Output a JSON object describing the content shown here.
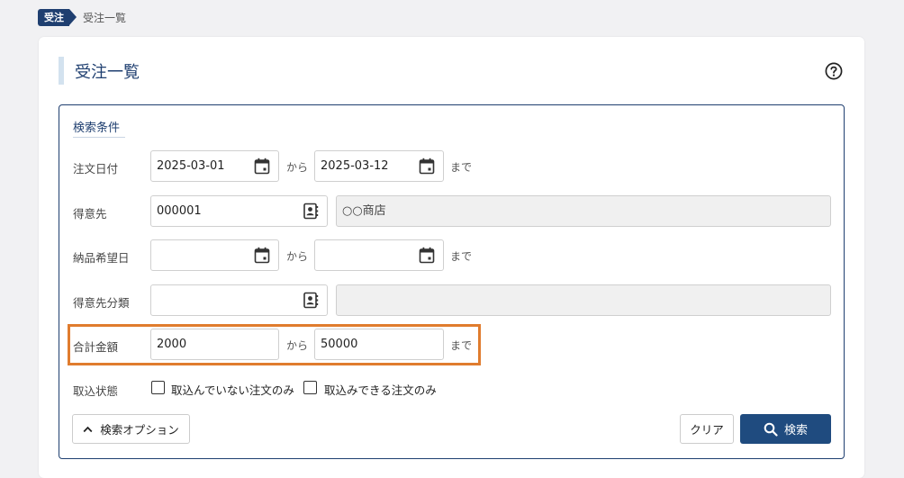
{
  "breadcrumb": {
    "tag": "受注",
    "current": "受注一覧"
  },
  "page": {
    "title": "受注一覧"
  },
  "search": {
    "legend": "検索条件",
    "range_from": "から",
    "range_to": "まで",
    "order_date": {
      "label": "注文日付",
      "from": "2025-03-01",
      "to": "2025-03-12"
    },
    "customer": {
      "label": "得意先",
      "code": "000001",
      "name": "○○商店"
    },
    "delivery_date": {
      "label": "納品希望日",
      "from": "",
      "to": ""
    },
    "customer_class": {
      "label": "得意先分類",
      "code": "",
      "name": ""
    },
    "total_amount": {
      "label": "合計金額",
      "from": "2000",
      "to": "50000"
    },
    "import_status": {
      "label": "取込状態",
      "options": [
        {
          "label": "取込んでいない注文のみ",
          "checked": false
        },
        {
          "label": "取込みできる注文のみ",
          "checked": false
        }
      ]
    }
  },
  "buttons": {
    "options": "検索オプション",
    "clear": "クリア",
    "search": "検索"
  },
  "icons": {
    "calendar": "calendar-icon",
    "contact": "contact-book-icon",
    "help": "help-circle-icon",
    "chevron": "chevron-up-icon",
    "search": "search-icon"
  },
  "colors": {
    "primary": "#1f3f70",
    "highlight": "#e07c2e",
    "readonly_bg": "#f0f0f0"
  }
}
